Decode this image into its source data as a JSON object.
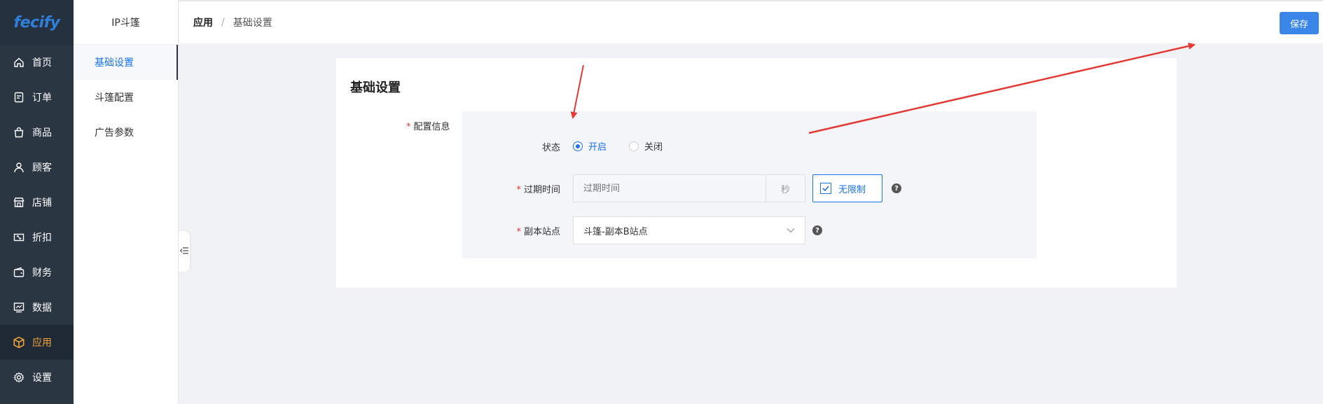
{
  "brand": {
    "logo": "fecify"
  },
  "nav": {
    "items": [
      {
        "label": "首页",
        "icon": "home-icon"
      },
      {
        "label": "订单",
        "icon": "order-icon"
      },
      {
        "label": "商品",
        "icon": "bag-icon"
      },
      {
        "label": "顾客",
        "icon": "user-icon"
      },
      {
        "label": "店铺",
        "icon": "store-icon"
      },
      {
        "label": "折扣",
        "icon": "ticket-icon"
      },
      {
        "label": "财务",
        "icon": "wallet-icon"
      },
      {
        "label": "数据",
        "icon": "chart-icon"
      },
      {
        "label": "应用",
        "icon": "cube-icon",
        "active": true
      },
      {
        "label": "设置",
        "icon": "gear-icon"
      }
    ]
  },
  "submenu": {
    "title": "IP斗篷",
    "items": [
      {
        "label": "基础设置",
        "active": true
      },
      {
        "label": "斗篷配置"
      },
      {
        "label": "广告参数"
      }
    ]
  },
  "header": {
    "breadcrumb": [
      "应用",
      "基础设置"
    ],
    "save_label": "保存"
  },
  "card": {
    "title": "基础设置",
    "config_label": "配置信息",
    "status": {
      "label": "状态",
      "options": [
        "开启",
        "关闭"
      ],
      "selected": "开启"
    },
    "expire": {
      "label": "过期时间",
      "placeholder": "过期时间",
      "suffix": "秒",
      "unlimited_label": "无限制",
      "unlimited_checked": true
    },
    "mirror_site": {
      "label": "副本站点",
      "value": "斗篷-副本B站点"
    },
    "help_glyph": "?"
  },
  "colors": {
    "accent": "#1a73e8",
    "nav_bg": "#2b3643",
    "nav_active": "#f0a43a",
    "save_button": "#3a86e8",
    "arrow": "#e53935"
  }
}
